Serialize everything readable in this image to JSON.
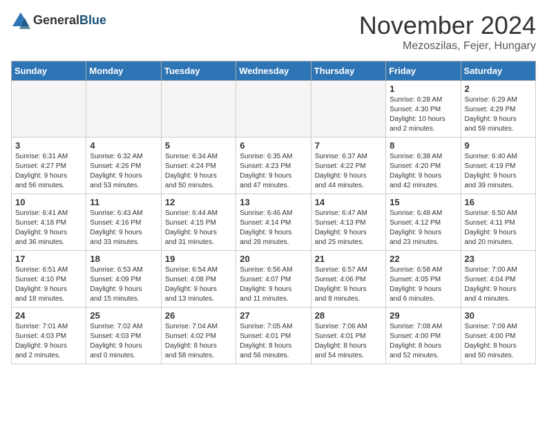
{
  "logo": {
    "general": "General",
    "blue": "Blue"
  },
  "title": "November 2024",
  "location": "Mezoszilas, Fejer, Hungary",
  "days_of_week": [
    "Sunday",
    "Monday",
    "Tuesday",
    "Wednesday",
    "Thursday",
    "Friday",
    "Saturday"
  ],
  "weeks": [
    [
      {
        "day": "",
        "info": ""
      },
      {
        "day": "",
        "info": ""
      },
      {
        "day": "",
        "info": ""
      },
      {
        "day": "",
        "info": ""
      },
      {
        "day": "",
        "info": ""
      },
      {
        "day": "1",
        "info": "Sunrise: 6:28 AM\nSunset: 4:30 PM\nDaylight: 10 hours\nand 2 minutes."
      },
      {
        "day": "2",
        "info": "Sunrise: 6:29 AM\nSunset: 4:29 PM\nDaylight: 9 hours\nand 59 minutes."
      }
    ],
    [
      {
        "day": "3",
        "info": "Sunrise: 6:31 AM\nSunset: 4:27 PM\nDaylight: 9 hours\nand 56 minutes."
      },
      {
        "day": "4",
        "info": "Sunrise: 6:32 AM\nSunset: 4:26 PM\nDaylight: 9 hours\nand 53 minutes."
      },
      {
        "day": "5",
        "info": "Sunrise: 6:34 AM\nSunset: 4:24 PM\nDaylight: 9 hours\nand 50 minutes."
      },
      {
        "day": "6",
        "info": "Sunrise: 6:35 AM\nSunset: 4:23 PM\nDaylight: 9 hours\nand 47 minutes."
      },
      {
        "day": "7",
        "info": "Sunrise: 6:37 AM\nSunset: 4:22 PM\nDaylight: 9 hours\nand 44 minutes."
      },
      {
        "day": "8",
        "info": "Sunrise: 6:38 AM\nSunset: 4:20 PM\nDaylight: 9 hours\nand 42 minutes."
      },
      {
        "day": "9",
        "info": "Sunrise: 6:40 AM\nSunset: 4:19 PM\nDaylight: 9 hours\nand 39 minutes."
      }
    ],
    [
      {
        "day": "10",
        "info": "Sunrise: 6:41 AM\nSunset: 4:18 PM\nDaylight: 9 hours\nand 36 minutes."
      },
      {
        "day": "11",
        "info": "Sunrise: 6:43 AM\nSunset: 4:16 PM\nDaylight: 9 hours\nand 33 minutes."
      },
      {
        "day": "12",
        "info": "Sunrise: 6:44 AM\nSunset: 4:15 PM\nDaylight: 9 hours\nand 31 minutes."
      },
      {
        "day": "13",
        "info": "Sunrise: 6:46 AM\nSunset: 4:14 PM\nDaylight: 9 hours\nand 28 minutes."
      },
      {
        "day": "14",
        "info": "Sunrise: 6:47 AM\nSunset: 4:13 PM\nDaylight: 9 hours\nand 25 minutes."
      },
      {
        "day": "15",
        "info": "Sunrise: 6:48 AM\nSunset: 4:12 PM\nDaylight: 9 hours\nand 23 minutes."
      },
      {
        "day": "16",
        "info": "Sunrise: 6:50 AM\nSunset: 4:11 PM\nDaylight: 9 hours\nand 20 minutes."
      }
    ],
    [
      {
        "day": "17",
        "info": "Sunrise: 6:51 AM\nSunset: 4:10 PM\nDaylight: 9 hours\nand 18 minutes."
      },
      {
        "day": "18",
        "info": "Sunrise: 6:53 AM\nSunset: 4:09 PM\nDaylight: 9 hours\nand 15 minutes."
      },
      {
        "day": "19",
        "info": "Sunrise: 6:54 AM\nSunset: 4:08 PM\nDaylight: 9 hours\nand 13 minutes."
      },
      {
        "day": "20",
        "info": "Sunrise: 6:56 AM\nSunset: 4:07 PM\nDaylight: 9 hours\nand 11 minutes."
      },
      {
        "day": "21",
        "info": "Sunrise: 6:57 AM\nSunset: 4:06 PM\nDaylight: 9 hours\nand 8 minutes."
      },
      {
        "day": "22",
        "info": "Sunrise: 6:58 AM\nSunset: 4:05 PM\nDaylight: 9 hours\nand 6 minutes."
      },
      {
        "day": "23",
        "info": "Sunrise: 7:00 AM\nSunset: 4:04 PM\nDaylight: 9 hours\nand 4 minutes."
      }
    ],
    [
      {
        "day": "24",
        "info": "Sunrise: 7:01 AM\nSunset: 4:03 PM\nDaylight: 9 hours\nand 2 minutes."
      },
      {
        "day": "25",
        "info": "Sunrise: 7:02 AM\nSunset: 4:03 PM\nDaylight: 9 hours\nand 0 minutes."
      },
      {
        "day": "26",
        "info": "Sunrise: 7:04 AM\nSunset: 4:02 PM\nDaylight: 8 hours\nand 58 minutes."
      },
      {
        "day": "27",
        "info": "Sunrise: 7:05 AM\nSunset: 4:01 PM\nDaylight: 8 hours\nand 56 minutes."
      },
      {
        "day": "28",
        "info": "Sunrise: 7:06 AM\nSunset: 4:01 PM\nDaylight: 8 hours\nand 54 minutes."
      },
      {
        "day": "29",
        "info": "Sunrise: 7:08 AM\nSunset: 4:00 PM\nDaylight: 8 hours\nand 52 minutes."
      },
      {
        "day": "30",
        "info": "Sunrise: 7:09 AM\nSunset: 4:00 PM\nDaylight: 8 hours\nand 50 minutes."
      }
    ]
  ]
}
